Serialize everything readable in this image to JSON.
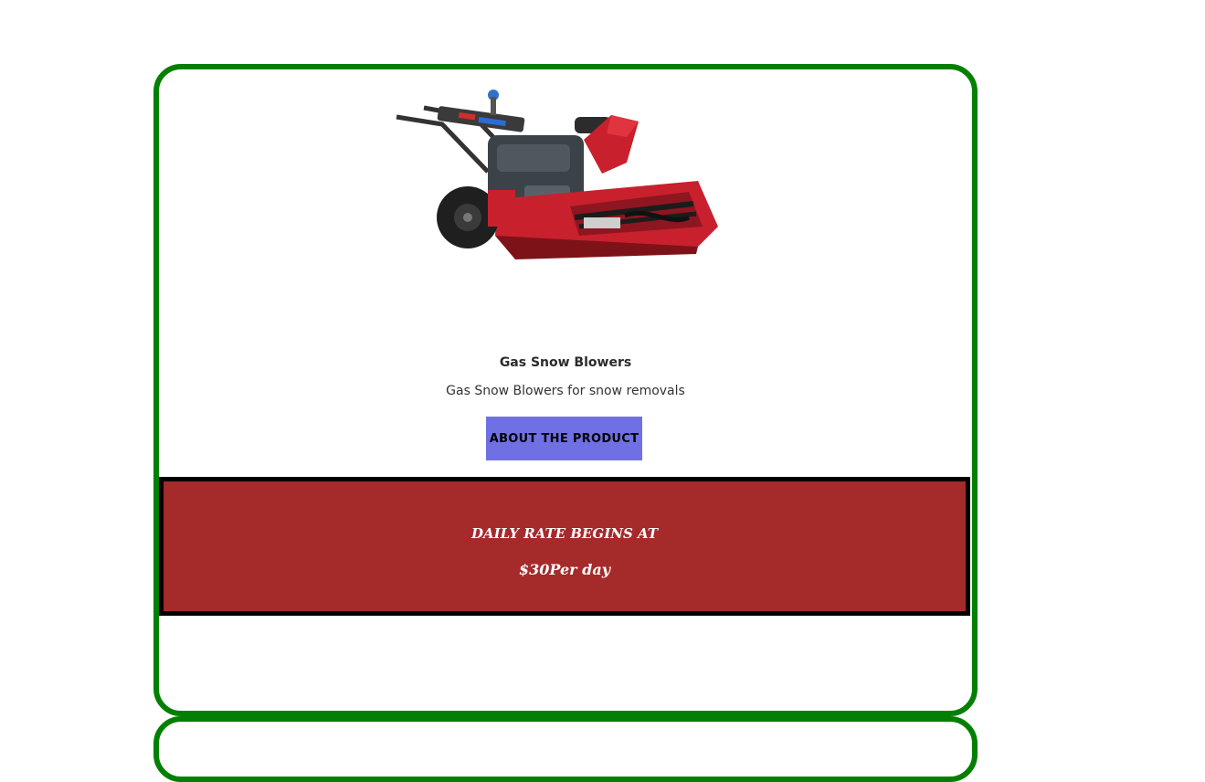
{
  "product": {
    "image_alt": "Gas snow blower",
    "title": "Gas Snow Blowers",
    "description": "Gas Snow Blowers for snow removals",
    "button_label": "ABOUT THE PRODUCT"
  },
  "rate": {
    "heading": "DAILY RATE BEGINS AT",
    "price": "$30Per day"
  },
  "colors": {
    "card_border": "#038003",
    "button_bg": "#7070e5",
    "banner_bg": "#a52a2a",
    "banner_border": "#000000",
    "snowblower_body": "#c8202d"
  }
}
